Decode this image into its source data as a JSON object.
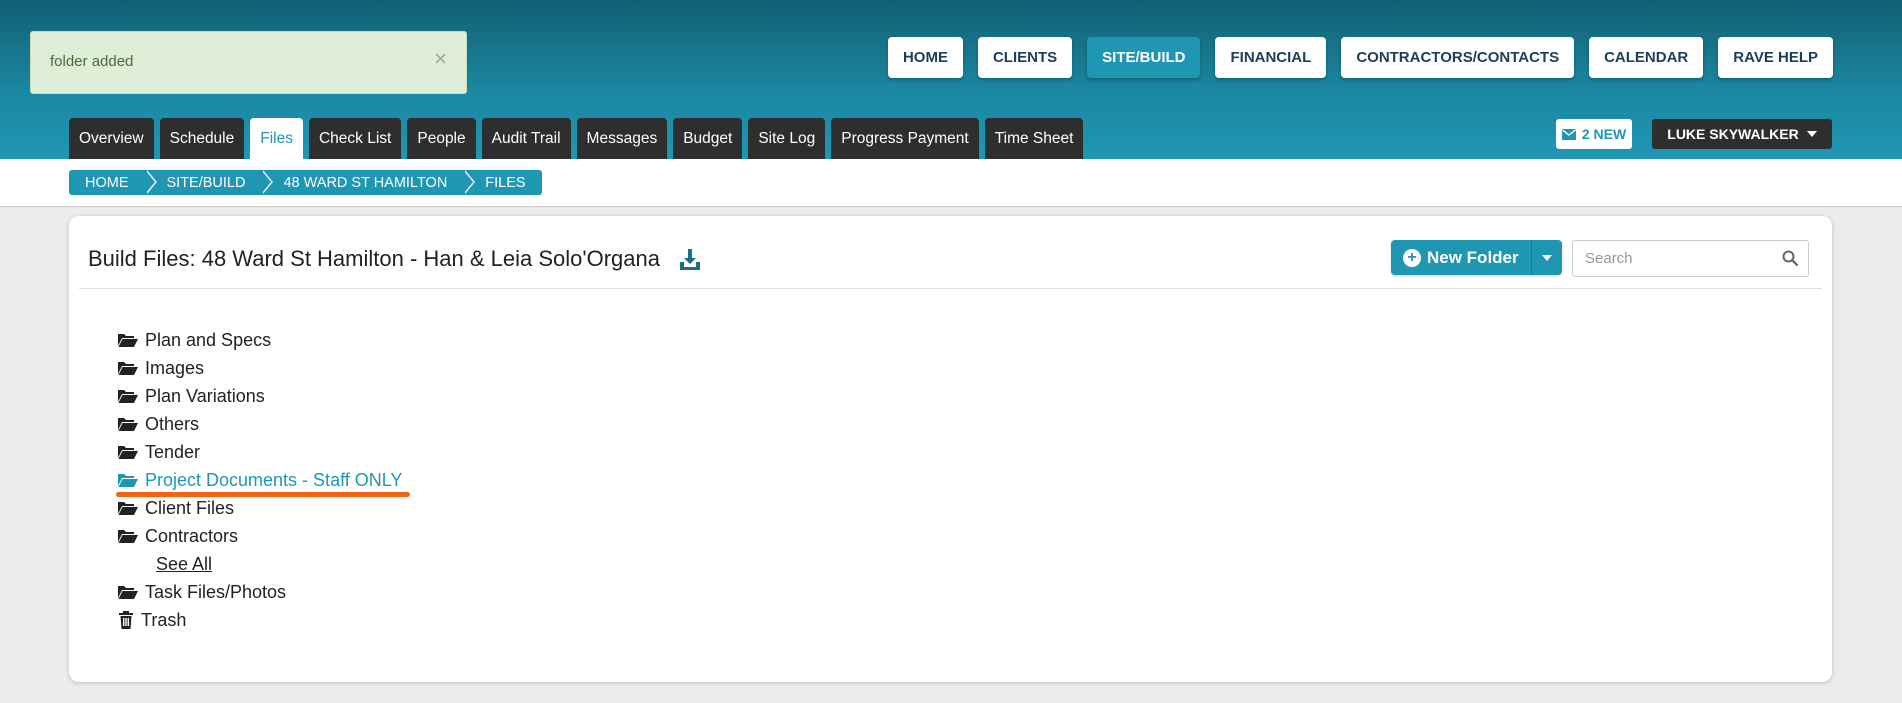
{
  "alert": {
    "message": "folder added",
    "close": "×"
  },
  "topnav": [
    {
      "label": "HOME",
      "active": false
    },
    {
      "label": "CLIENTS",
      "active": false
    },
    {
      "label": "SITE/BUILD",
      "active": true
    },
    {
      "label": "FINANCIAL",
      "active": false
    },
    {
      "label": "CONTRACTORS/CONTACTS",
      "active": false
    },
    {
      "label": "CALENDAR",
      "active": false
    },
    {
      "label": "RAVE HELP",
      "active": false
    }
  ],
  "tabs": [
    "Overview",
    "Schedule",
    "Files",
    "Check List",
    "People",
    "Audit Trail",
    "Messages",
    "Budget",
    "Site Log",
    "Progress Payment",
    "Time Sheet"
  ],
  "active_tab": "Files",
  "messages": {
    "label": "2 NEW",
    "icon": "envelope-icon"
  },
  "user": {
    "name": "LUKE SKYWALKER"
  },
  "breadcrumb": [
    "HOME",
    "SITE/BUILD",
    "48 WARD ST HAMILTON",
    "FILES"
  ],
  "page": {
    "title": "Build Files: 48 Ward St Hamilton - Han & Leia Solo'Organa",
    "new_folder_label": "New Folder",
    "search_placeholder": "Search"
  },
  "folders": [
    {
      "label": "Plan and Specs",
      "icon": "folder-open-icon"
    },
    {
      "label": "Images",
      "icon": "folder-open-icon"
    },
    {
      "label": "Plan Variations",
      "icon": "folder-open-icon"
    },
    {
      "label": "Others",
      "icon": "folder-open-icon"
    },
    {
      "label": "Tender",
      "icon": "folder-open-icon"
    },
    {
      "label": "Project Documents - Staff ONLY",
      "icon": "folder-open-icon",
      "highlighted": true
    },
    {
      "label": "Client Files",
      "icon": "folder-open-icon"
    },
    {
      "label": "Contractors",
      "icon": "folder-open-icon"
    },
    {
      "label": "See All",
      "type": "link"
    },
    {
      "label": "Task Files/Photos",
      "icon": "folder-open-icon"
    },
    {
      "label": "Trash",
      "icon": "trash-icon"
    }
  ],
  "colors": {
    "accent": "#1f97b3",
    "dark": "#2e2e2e",
    "annotation": "#f06414",
    "alert_bg": "#dfeed7"
  }
}
